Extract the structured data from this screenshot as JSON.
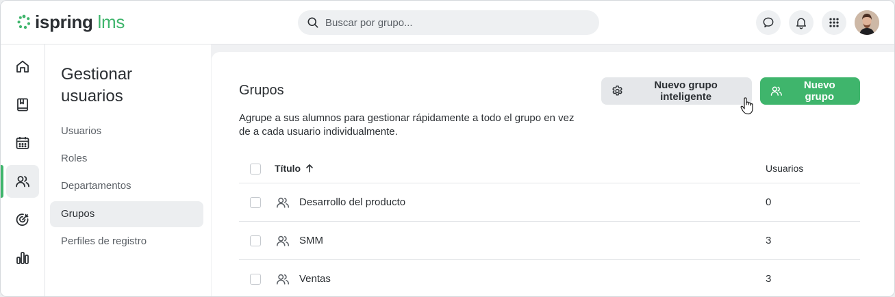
{
  "brand": {
    "name_a": "ispring",
    "name_b": "lms",
    "accent": "#3fb56c"
  },
  "search": {
    "placeholder": "Buscar por grupo..."
  },
  "topbar": {
    "icons": [
      "chat-icon",
      "bell-icon",
      "apps-grid-icon",
      "avatar"
    ]
  },
  "rail": {
    "items": [
      "home-icon",
      "book-icon",
      "calendar-icon",
      "users-icon",
      "target-icon",
      "chart-icon"
    ],
    "active": "users-icon"
  },
  "subnav": {
    "title": "Gestionar usuarios",
    "items": [
      {
        "label": "Usuarios"
      },
      {
        "label": "Roles"
      },
      {
        "label": "Departamentos"
      },
      {
        "label": "Grupos",
        "active": true
      },
      {
        "label": "Perfiles de registro"
      }
    ]
  },
  "main": {
    "title": "Grupos",
    "description": "Agrupe a sus alumnos para gestionar rápidamente a todo el grupo en vez de a cada usuario individualmente.",
    "smart_group_label": "Nuevo grupo inteligente",
    "new_group_label": "Nuevo grupo",
    "table": {
      "col_title": "Título",
      "col_users": "Usuarios",
      "rows": [
        {
          "name": "Desarrollo del producto",
          "users": "0"
        },
        {
          "name": "SMM",
          "users": "3"
        },
        {
          "name": "Ventas",
          "users": "3"
        }
      ]
    }
  }
}
